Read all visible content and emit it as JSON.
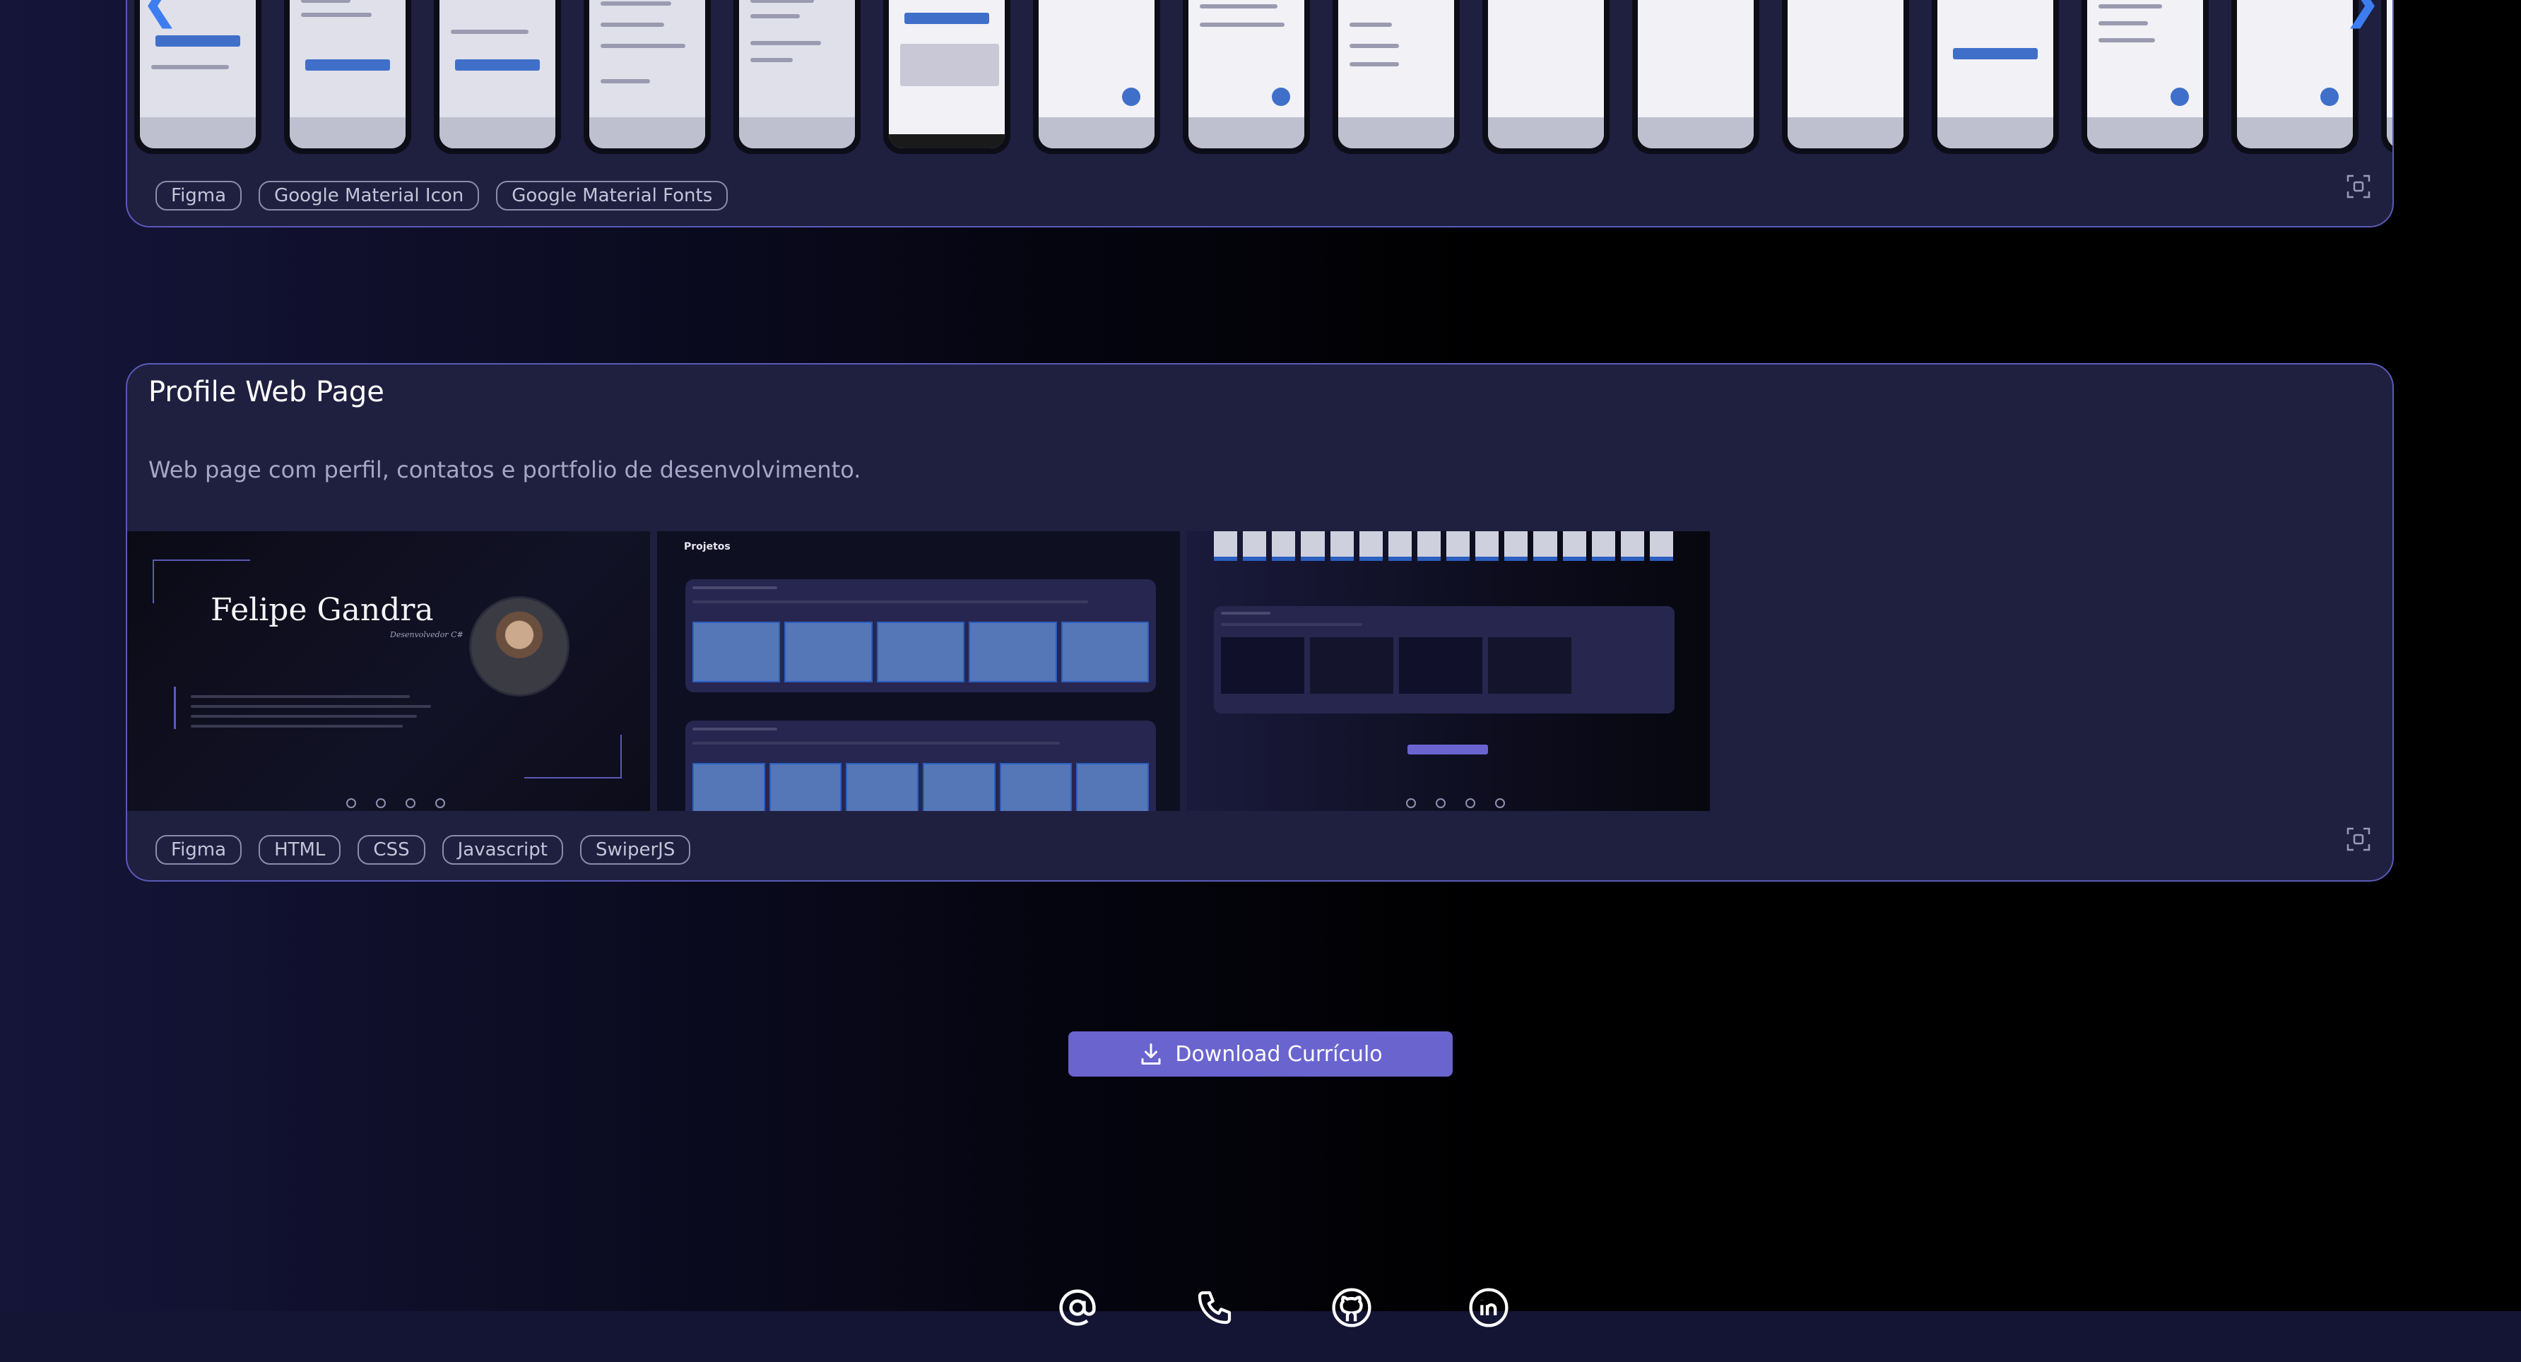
{
  "projects": [
    {
      "tags": [
        "Figma",
        "Google Material Icon",
        "Google Material Fonts"
      ],
      "carousel": {
        "prev_icon": "chevron-left-icon",
        "next_icon": "chevron-right-icon"
      },
      "fullscreen_icon": "fullscreen-icon"
    },
    {
      "title": "Profile Web Page",
      "description": "Web page com perfil, contatos e portfolio de desenvolvimento.",
      "tags": [
        "Figma",
        "HTML",
        "CSS",
        "Javascript",
        "SwiperJS"
      ],
      "previews": {
        "profile_name": "Felipe Gandra",
        "profile_role": "Desenvolvedor C#",
        "projects_heading": "Projetos"
      },
      "fullscreen_icon": "fullscreen-icon"
    }
  ],
  "download": {
    "label": "Download Currículo",
    "icon": "download-icon",
    "color": "#6a64cf"
  },
  "contacts": [
    {
      "icon": "at-sign-icon"
    },
    {
      "icon": "phone-icon"
    },
    {
      "icon": "github-icon"
    },
    {
      "icon": "linkedin-icon"
    }
  ],
  "colors": {
    "card_border": "#5a5ab8",
    "card_background": "#1f1f40",
    "accent_blue": "#3c7df0"
  }
}
